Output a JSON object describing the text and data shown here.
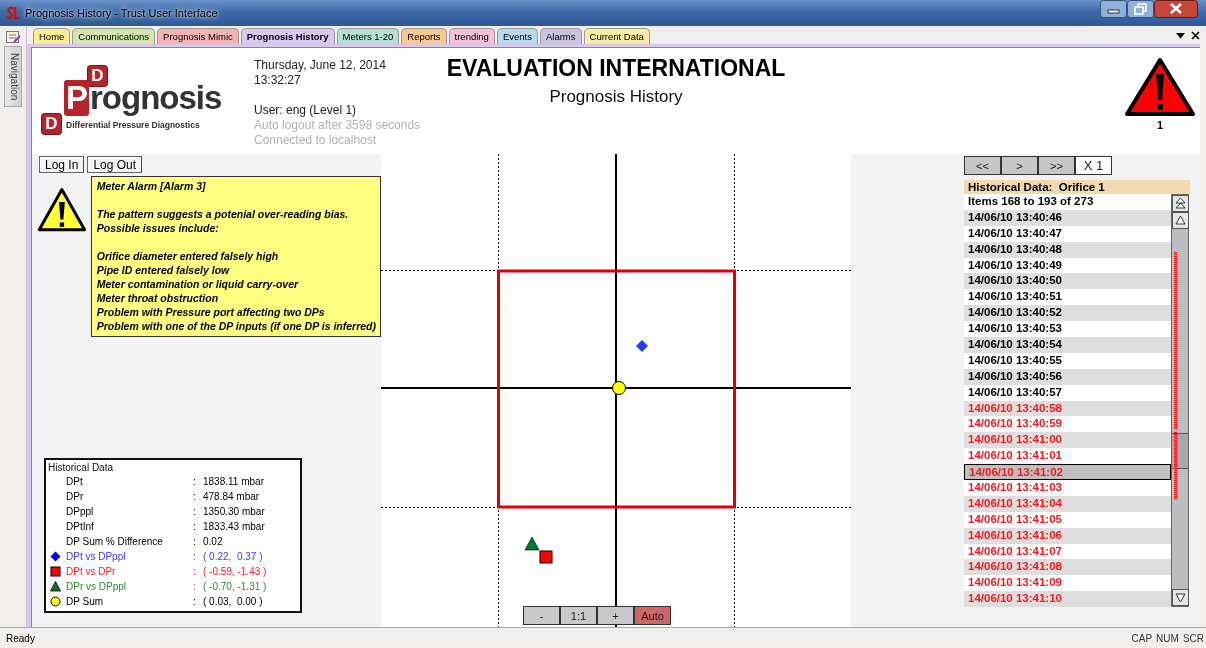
{
  "window": {
    "title": "Prognosis History - Trust User Interface"
  },
  "navigation": {
    "label": "Navigation"
  },
  "tabs": [
    {
      "label": "Home",
      "color": "#fbee8c",
      "selected": false
    },
    {
      "label": "Communications",
      "color": "#d3e6ae",
      "selected": false
    },
    {
      "label": "Prognosis Mimic",
      "color": "#f6b3b3",
      "selected": false
    },
    {
      "label": "Prognosis History",
      "color": "#d7c9f2",
      "selected": true
    },
    {
      "label": "Meters 1-20",
      "color": "#b5e0cf",
      "selected": false
    },
    {
      "label": "Reports",
      "color": "#f9c78f",
      "selected": false
    },
    {
      "label": "trending",
      "color": "#f3c0d6",
      "selected": false
    },
    {
      "label": "Events",
      "color": "#b8d9f1",
      "selected": false
    },
    {
      "label": "Alarms",
      "color": "#cac3e2",
      "selected": false
    },
    {
      "label": "Current Data",
      "color": "#f8eba2",
      "selected": false
    }
  ],
  "header": {
    "logo": {
      "badges": [
        "D",
        "D"
      ],
      "wordmark": "Prognosis",
      "tagline": "Differential Pressure Diagnostics"
    },
    "info": [
      [
        {
          "text": "Thursday, June 12, 2014",
          "dimmed": false
        },
        {
          "text": "13:32:27",
          "dimmed": false
        }
      ],
      [
        {
          "text": "User: eng (Level 1)",
          "dimmed": false
        },
        {
          "text": "Auto logout after 3598 seconds",
          "dimmed": true
        },
        {
          "text": "Connected to localhost",
          "dimmed": true
        }
      ]
    ],
    "title": "EVALUATION INTERNATIONAL",
    "subtitle": "Prognosis History",
    "alarm_count": "1"
  },
  "login_buttons": [
    "Log In",
    "Log Out"
  ],
  "alarm_message": {
    "title": "Meter Alarm [Alarm 3]",
    "paragraphs": [
      [
        "The pattern suggests a potenial over-reading bias.",
        "Possible issues include:"
      ],
      [
        "Orifice diameter entered falsely high",
        "Pipe ID entered falsely low",
        "Meter contamination or liquid carry-over",
        "Meter throat obstruction",
        "Problem with Pressure port affecting two DPs",
        "Problem with one of the DP inputs (if one DP is inferred)"
      ]
    ]
  },
  "historical_data": {
    "title": "Historical Data",
    "rows": [
      {
        "kind": "value",
        "label": "DPt",
        "separator": ":",
        "value": "1838.11 mbar"
      },
      {
        "kind": "value",
        "label": "DPr",
        "separator": ":",
        "value": "478.84 mbar"
      },
      {
        "kind": "value",
        "label": "DPppl",
        "separator": ":",
        "value": "1350.30 mbar"
      },
      {
        "kind": "value",
        "label": "DPtInf",
        "separator": ":",
        "value": "1833.43 mbar"
      },
      {
        "kind": "value",
        "label": "DP Sum % Difference",
        "separator": ":",
        "value": "0.02"
      },
      {
        "kind": "diamond",
        "label": "DPt vs DPppl",
        "separator": ":",
        "value": "( 0.22,  0.37 )",
        "color": "#3a3aff",
        "marker": {
          "color": "#0000ff"
        }
      },
      {
        "kind": "square",
        "label": "DPt vs DPr",
        "separator": ":",
        "value": "( -0.59, -1.43 )",
        "color": "#ff2020",
        "marker": {
          "color": "#ff0000"
        }
      },
      {
        "kind": "triangle",
        "label": "DPr vs DPppl",
        "separator": ":",
        "value": "( -0.70, -1.31 )",
        "color": "#2e8b2e",
        "marker": {
          "color": "#007a33"
        }
      },
      {
        "kind": "circle",
        "label": "DP Sum",
        "separator": ":",
        "value": "( 0.03,  0.00 )",
        "marker": {
          "color": "#ffff00"
        }
      }
    ]
  },
  "zoom_buttons": [
    {
      "label": "-",
      "on": false
    },
    {
      "label": "1:1",
      "on": false
    },
    {
      "label": "+",
      "on": false
    },
    {
      "label": "Auto",
      "on": true
    }
  ],
  "record_nav": [
    {
      "label": "<<",
      "on": false
    },
    {
      "label": ">",
      "on": false
    },
    {
      "label": ">>",
      "on": false
    },
    {
      "label": "X 1",
      "on": true
    }
  ],
  "record_list": {
    "title": "Historical Data:  Orifice 1",
    "summary": "Items 168 to 193 of 273",
    "rows": [
      {
        "time": "14/06/10 13:40:46",
        "alarm": false,
        "selected": false
      },
      {
        "time": "14/06/10 13:40:47",
        "alarm": false,
        "selected": false
      },
      {
        "time": "14/06/10 13:40:48",
        "alarm": false,
        "selected": false
      },
      {
        "time": "14/06/10 13:40:49",
        "alarm": false,
        "selected": false
      },
      {
        "time": "14/06/10 13:40:50",
        "alarm": false,
        "selected": false
      },
      {
        "time": "14/06/10 13:40:51",
        "alarm": false,
        "selected": false
      },
      {
        "time": "14/06/10 13:40:52",
        "alarm": false,
        "selected": false
      },
      {
        "time": "14/06/10 13:40:53",
        "alarm": false,
        "selected": false
      },
      {
        "time": "14/06/10 13:40:54",
        "alarm": false,
        "selected": false
      },
      {
        "time": "14/06/10 13:40:55",
        "alarm": false,
        "selected": false
      },
      {
        "time": "14/06/10 13:40:56",
        "alarm": false,
        "selected": false
      },
      {
        "time": "14/06/10 13:40:57",
        "alarm": false,
        "selected": false
      },
      {
        "time": "14/06/10 13:40:58",
        "alarm": true,
        "selected": false
      },
      {
        "time": "14/06/10 13:40:59",
        "alarm": true,
        "selected": false
      },
      {
        "time": "14/06/10 13:41:00",
        "alarm": true,
        "selected": false
      },
      {
        "time": "14/06/10 13:41:01",
        "alarm": true,
        "selected": false
      },
      {
        "time": "14/06/10 13:41:02",
        "alarm": true,
        "selected": true
      },
      {
        "time": "14/06/10 13:41:03",
        "alarm": true,
        "selected": false
      },
      {
        "time": "14/06/10 13:41:04",
        "alarm": true,
        "selected": false
      },
      {
        "time": "14/06/10 13:41:05",
        "alarm": true,
        "selected": false
      },
      {
        "time": "14/06/10 13:41:06",
        "alarm": true,
        "selected": false
      },
      {
        "time": "14/06/10 13:41:07",
        "alarm": true,
        "selected": false
      },
      {
        "time": "14/06/10 13:41:08",
        "alarm": true,
        "selected": false
      },
      {
        "time": "14/06/10 13:41:09",
        "alarm": true,
        "selected": false
      },
      {
        "time": "14/06/10 13:41:10",
        "alarm": true,
        "selected": false
      }
    ]
  },
  "status_bar": {
    "text": "Ready",
    "indicators": [
      "CAP",
      "NUM",
      "SCR"
    ]
  }
}
